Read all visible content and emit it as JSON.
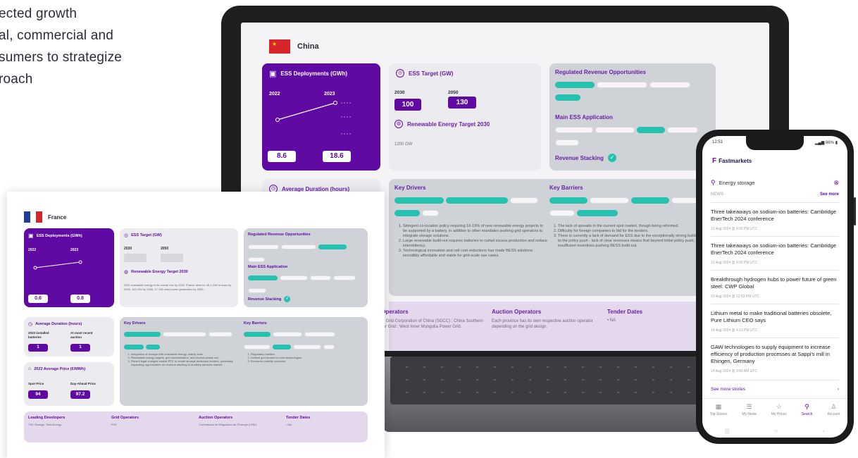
{
  "hero": {
    "lines": [
      "ected growth",
      "al, commercial and",
      "sumers to strategize",
      "roach"
    ]
  },
  "laptop": {
    "country": "China",
    "ess_deployments": {
      "title": "ESS Deployments (GWh)",
      "year_a": "2022",
      "year_b": "2023",
      "value_a": "8.6",
      "value_b": "18.6"
    },
    "ess_target": {
      "title": "ESS Target (GW)",
      "year_a": "2030",
      "year_b": "2050",
      "value_a": "100",
      "value_b": "130"
    },
    "renewable_target": {
      "title": "Renewable Energy Target 2030",
      "value": "1200 GW"
    },
    "regulated_revenue": {
      "title": "Regulated Revenue Opportunities"
    },
    "main_application": {
      "title": "Main ESS Application"
    },
    "revenue_stacking": {
      "title": "Revenue Stacking"
    },
    "avg_duration": {
      "title": "Average Duration (hours)"
    },
    "key_drivers": {
      "title": "Key Drivers",
      "items": [
        "Stringent co-location policy requiring 10-15% of new renewable energy projects to be supported by a battery, in addition to other mandates pushing grid operators to integrate storage solutions.",
        "Large renewable build-out requires batteries to curtail excess production and reduce intermittency.",
        "Technological innovation and cell cost reductions has made BESS solutions incredibly affordable and viable for grid-scale use cases."
      ]
    },
    "key_barriers": {
      "title": "Key Barriers",
      "items": [
        "The lack of spreads in the current spot market, though being reformed.",
        "Difficulty for foreign companies to bid for the tenders.",
        "There is currently a lack of demand for ESS due to the exceptionally strong build out due to the policy push - lack of clear revenues means that beyond initial policy push, there are insufficient incentives pushing BESS build out."
      ]
    },
    "grid_operators": {
      "title": "id Operators",
      "text": "State Grid Corporation of China (SGCC) ; China Southern Power Grid ; West Inner Mongolia Power Grid."
    },
    "auction_operators": {
      "title": "Auction Operators",
      "text": "Each province has its own respective auction operator depending on the grid design."
    },
    "tender_dates": {
      "title": "Tender Dates",
      "text": "NA"
    }
  },
  "report": {
    "country": "France",
    "ess_deployments": {
      "title": "ESS Deployments (GWh)",
      "year_a": "2022",
      "year_b": "2023",
      "value_a": "0.6",
      "value_b": "0.8"
    },
    "ess_target": {
      "title": "ESS Target (GW)",
      "year_a": "2030",
      "year_b": "2050"
    },
    "renewable_target": {
      "title": "Renewable Energy Target 2030",
      "value": "33% renewable energy in its overall mix by 2030. France aims for 48.1 GW of solar by 2030, 100 GW by 2050, 17 GW wind power generation by 2050."
    },
    "regulated_revenue": {
      "title": "Regulated Revenue Opportunities"
    },
    "main_application": {
      "title": "Main ESS Application"
    },
    "revenue_stacking": {
      "title": "Revenue Stacking"
    },
    "avg_duration": {
      "title": "Average Duration (hours)",
      "label_a": "2023 installed batteries",
      "label_b": "At most recent auction",
      "value_a": "1",
      "value_b": "1"
    },
    "avg_price": {
      "title": "2023 Average Price (€/MWh)",
      "label_a": "Spot Price",
      "label_b": "Day-Ahead Price",
      "value_a": "94",
      "value_b": "97.2"
    },
    "key_drivers": {
      "title": "Key Drivers",
      "items": [
        "Integration of storage with renewable energy, mainly solar.",
        "Renewable energy targets, grid modernisation, and nuclear phase out.",
        "Recent legal changes enable RTE to create storage dedicated tenders, potentially expanding opportunities for revenue stacking to ancillary services market."
      ]
    },
    "key_barriers": {
      "title": "Key Barriers",
      "items": [
        "Regulatory hurdles.",
        "Limited grid access for new technologies.",
        "Economic viability concerns."
      ]
    },
    "leading_developers": {
      "title": "Leading Developers",
      "text": "TSK Storage, Total Energy"
    },
    "grid_operators": {
      "title": "Grid Operators",
      "text": "RTE"
    },
    "auction_operators": {
      "title": "Auction Operators",
      "text": "Commission de Régulation de l'Énergie (CRE)"
    },
    "tender_dates": {
      "title": "Tender Dates",
      "text": "NA"
    }
  },
  "phone": {
    "time": "12:51",
    "battery": "86%",
    "brand": "Fastmarkets",
    "search_value": "Energy storage",
    "section_label": "NEWS",
    "see_more_label": "See more",
    "news": [
      {
        "title": "Three takeaways on sodium-ion batteries: Cambridge EnerTech 2024 conference",
        "date": "13 Aug 2024 @ 6:00 PM UTC"
      },
      {
        "title": "Three takeaways on sodium-ion batteries: Cambridge EnerTech 2024 conference",
        "date": "13 Aug 2024 @ 6:00 PM UTC"
      },
      {
        "title": "Breakthrough hydrogen hubs to power future of green steel: CWP Global",
        "date": "15 Aug 2024 @ 12:53 PM UTC"
      },
      {
        "title": "Lithium metal to make traditional batteries obsolete, Pure Lithium CEO says",
        "date": "14 Aug 2024 @ 4:13 PM UTC"
      },
      {
        "title": "GAW technologies to supply equipment to increase efficiency of production processes at Sappi's mill in Ehingen, Germany",
        "date": "14 Aug 2024 @ 3:50 AM UTC"
      }
    ],
    "see_more_stories": "See more stories",
    "tabs": [
      {
        "label": "Top Stories",
        "icon": "grid-icon"
      },
      {
        "label": "My News",
        "icon": "news-icon"
      },
      {
        "label": "My Prices",
        "icon": "star-icon"
      },
      {
        "label": "Search",
        "icon": "search-icon"
      },
      {
        "label": "Account",
        "icon": "person-icon"
      }
    ]
  },
  "colors": {
    "brand_purple": "#5e0aa3",
    "teal": "#27c1b0",
    "panel_grey": "#cfd3d8",
    "lilac": "#e4d8ec"
  }
}
